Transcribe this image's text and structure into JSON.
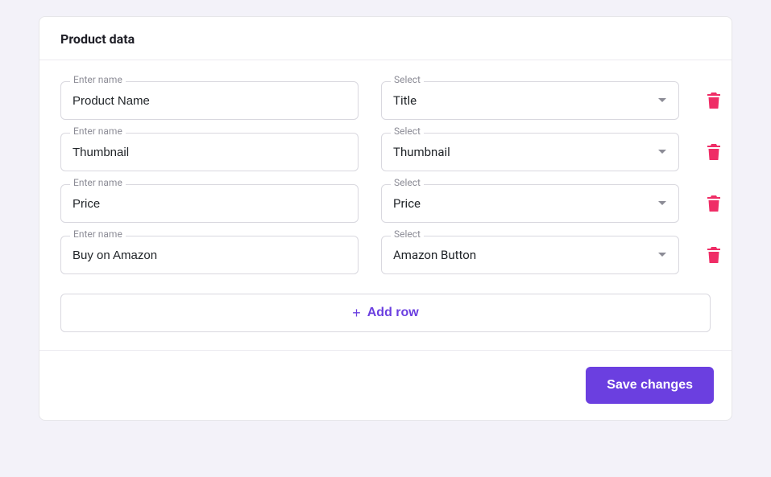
{
  "card": {
    "title": "Product data",
    "name_label": "Enter name",
    "select_label": "Select",
    "rows": [
      {
        "name": "Product Name",
        "select": "Title"
      },
      {
        "name": "Thumbnail",
        "select": "Thumbnail"
      },
      {
        "name": "Price",
        "select": "Price"
      },
      {
        "name": "Buy on Amazon",
        "select": "Amazon Button"
      }
    ],
    "add_row_label": "Add row",
    "save_label": "Save changes"
  },
  "colors": {
    "accent": "#6b3fe0",
    "danger": "#ef2d66"
  }
}
